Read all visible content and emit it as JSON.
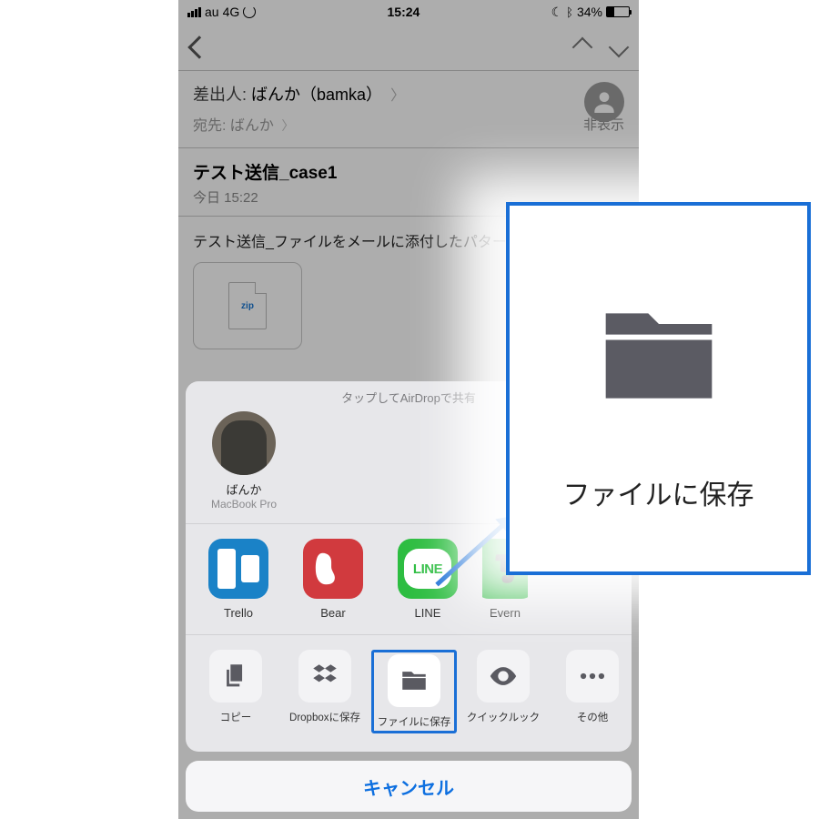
{
  "status": {
    "carrier": "au",
    "network": "4G",
    "time": "15:24",
    "battery_pct": "34%"
  },
  "mail": {
    "from_label": "差出人:",
    "from_name": "ばんか（bamka）",
    "to_label": "宛先:",
    "to_name": "ばんか",
    "hide": "非表示",
    "subject": "テスト送信_case1",
    "time": "今日 15:22",
    "body_text": "テスト送信_ファイルをメールに添付したパター",
    "attachment_ext": "zip"
  },
  "share": {
    "airdrop_hint": "タップしてAirDropで共有",
    "contact": {
      "name": "ばんか",
      "device": "MacBook Pro"
    },
    "apps": [
      {
        "label": "Trello"
      },
      {
        "label": "Bear"
      },
      {
        "label": "LINE"
      },
      {
        "label": "Evern"
      }
    ],
    "actions": [
      {
        "label": "コピー"
      },
      {
        "label": "Dropboxに保存"
      },
      {
        "label": "ファイルに保存"
      },
      {
        "label": "クイックルック"
      },
      {
        "label": "その他"
      }
    ],
    "cancel": "キャンセル"
  },
  "callout": {
    "label": "ファイルに保存"
  }
}
